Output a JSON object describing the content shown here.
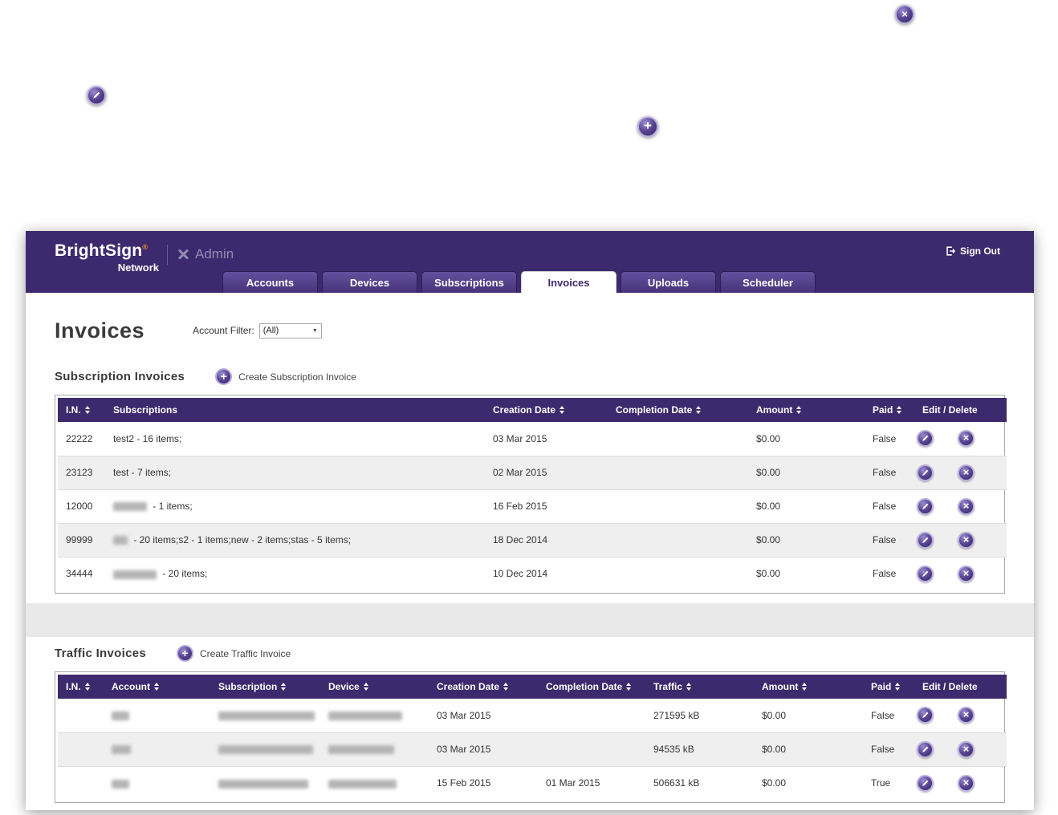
{
  "colors": {
    "header_purple": "#3d2a6e",
    "tab_purple": "#54428e",
    "accent_orange": "#f7941d",
    "row_alt_gray": "#efefef",
    "band_gray": "#e9e9e9",
    "icon_purple": "#5a4694"
  },
  "icons": {
    "close": "×",
    "add": "+",
    "edit": "pencil",
    "delete": "×",
    "sign_out": "exit-arrow",
    "admin": "crossed-tools",
    "sort": "up-down-arrows",
    "dropdown_arrow": "▼"
  },
  "header": {
    "logo_main": "BrightSign",
    "logo_reg": "®",
    "logo_sub": "Network",
    "admin_label": "Admin",
    "sign_out": "Sign Out"
  },
  "tabs": [
    {
      "label": "Accounts",
      "active": false
    },
    {
      "label": "Devices",
      "active": false
    },
    {
      "label": "Subscriptions",
      "active": false
    },
    {
      "label": "Invoices",
      "active": true
    },
    {
      "label": "Uploads",
      "active": false
    },
    {
      "label": "Scheduler",
      "active": false
    }
  ],
  "page": {
    "title": "Invoices",
    "account_filter_label": "Account Filter:",
    "account_filter_value": "(All)"
  },
  "subscription_invoices": {
    "heading": "Subscription Invoices",
    "create_label": "Create Subscription Invoice",
    "columns": [
      {
        "label": "I.N.",
        "sortable": true
      },
      {
        "label": "Subscriptions",
        "sortable": false
      },
      {
        "label": "Creation Date",
        "sortable": true
      },
      {
        "label": "Completion Date",
        "sortable": true
      },
      {
        "label": "Amount",
        "sortable": true
      },
      {
        "label": "Paid",
        "sortable": true
      },
      {
        "label": "Edit / Delete",
        "sortable": false
      }
    ],
    "rows": [
      {
        "in": "22222",
        "subscriptions": [
          {
            "text": "test2 - 16 items;"
          }
        ],
        "creation": "03 Mar 2015",
        "completion": "",
        "amount": "$0.00",
        "paid": "False"
      },
      {
        "in": "23123",
        "subscriptions": [
          {
            "text": "test - 7 items;"
          }
        ],
        "creation": "02 Mar 2015",
        "completion": "",
        "amount": "$0.00",
        "paid": "False"
      },
      {
        "in": "12000",
        "subscriptions": [
          {
            "blur": 42
          },
          {
            "text": " - 1 items;"
          }
        ],
        "creation": "16 Feb 2015",
        "completion": "",
        "amount": "$0.00",
        "paid": "False"
      },
      {
        "in": "99999",
        "subscriptions": [
          {
            "blur": 18
          },
          {
            "text": " - 20 items;s2 - 1 items;new - 2 items;stas - 5 items;"
          }
        ],
        "creation": "18 Dec 2014",
        "completion": "",
        "amount": "$0.00",
        "paid": "False"
      },
      {
        "in": "34444",
        "subscriptions": [
          {
            "blur": 54
          },
          {
            "text": " - 20 items;"
          }
        ],
        "creation": "10 Dec 2014",
        "completion": "",
        "amount": "$0.00",
        "paid": "False"
      }
    ]
  },
  "traffic_invoices": {
    "heading": "Traffic Invoices",
    "create_label": "Create Traffic Invoice",
    "columns": [
      {
        "label": "I.N.",
        "sortable": true
      },
      {
        "label": "Account",
        "sortable": true
      },
      {
        "label": "Subscription",
        "sortable": true
      },
      {
        "label": "Device",
        "sortable": true
      },
      {
        "label": "Creation Date",
        "sortable": true
      },
      {
        "label": "Completion Date",
        "sortable": true
      },
      {
        "label": "Traffic",
        "sortable": true
      },
      {
        "label": "Amount",
        "sortable": true
      },
      {
        "label": "Paid",
        "sortable": true
      },
      {
        "label": "Edit / Delete",
        "sortable": false
      }
    ],
    "rows": [
      {
        "in": "",
        "account": [
          {
            "blur": 22
          }
        ],
        "subscription": [
          {
            "blur": 120
          }
        ],
        "device": [
          {
            "blur": 92
          }
        ],
        "creation": "03 Mar 2015",
        "completion": "",
        "traffic": "271595 kB",
        "amount": "$0.00",
        "paid": "False"
      },
      {
        "in": "",
        "account": [
          {
            "blur": 24
          }
        ],
        "subscription": [
          {
            "blur": 118
          }
        ],
        "device": [
          {
            "blur": 82
          }
        ],
        "creation": "03 Mar 2015",
        "completion": "",
        "traffic": "94535 kB",
        "amount": "$0.00",
        "paid": "False"
      },
      {
        "in": "",
        "account": [
          {
            "blur": 22
          }
        ],
        "subscription": [
          {
            "blur": 112
          }
        ],
        "device": [
          {
            "blur": 85
          }
        ],
        "creation": "15 Feb 2015",
        "completion": "01 Mar 2015",
        "traffic": "506631 kB",
        "amount": "$0.00",
        "paid": "True"
      }
    ]
  }
}
